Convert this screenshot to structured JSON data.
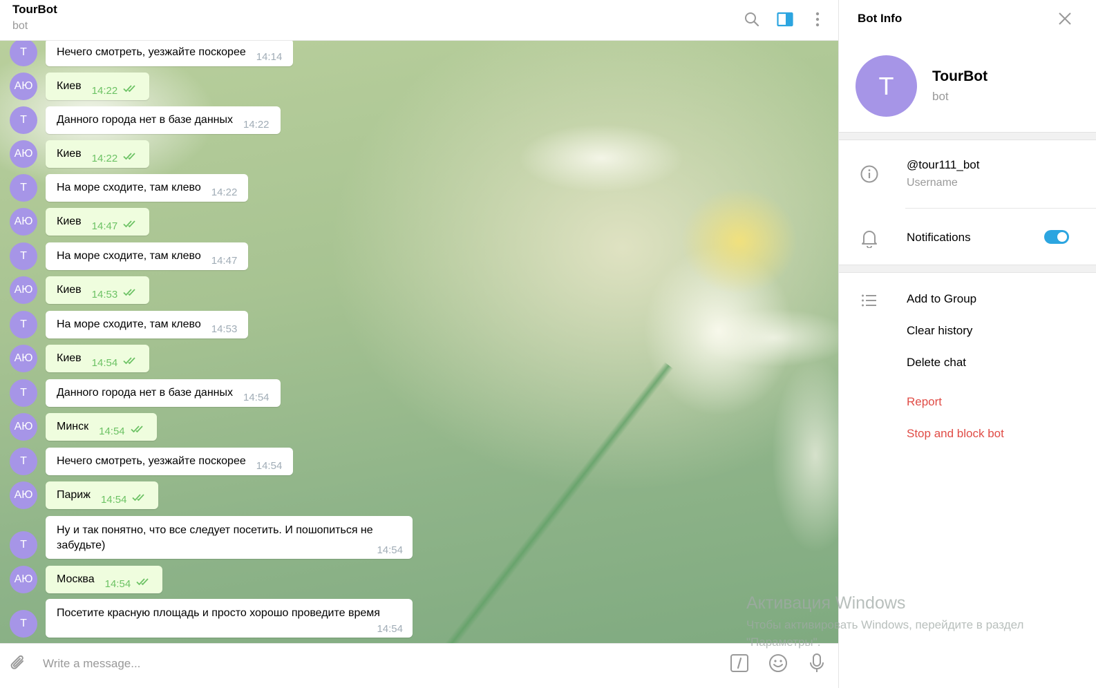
{
  "chat": {
    "title": "TourBot",
    "subtitle": "bot",
    "composer_placeholder": "Write a message..."
  },
  "icons": {
    "search": "search-icon",
    "sidebar_toggle": "sidebar-toggle-icon",
    "more": "more-vertical-icon",
    "attach": "paperclip-icon",
    "commands": "slash-commands-icon",
    "emoji": "emoji-icon",
    "mic": "microphone-icon",
    "close": "close-icon",
    "info": "info-icon",
    "bell": "bell-icon",
    "list": "list-icon",
    "read_receipt": "double-check-icon"
  },
  "colors": {
    "avatar": "#a695e7",
    "outgoing_bubble": "#effdde",
    "outgoing_time": "#6cc264",
    "accent": "#2ca5e0",
    "danger": "#e04c46"
  },
  "messages": [
    {
      "dir": "in",
      "avatar": "T",
      "text": "Нечего смотреть, уезжайте поскорее",
      "time": "14:14"
    },
    {
      "dir": "out",
      "avatar": "АЮ",
      "text": "Киев",
      "time": "14:22"
    },
    {
      "dir": "in",
      "avatar": "T",
      "text": "Данного города нет в базе данных",
      "time": "14:22"
    },
    {
      "dir": "out",
      "avatar": "АЮ",
      "text": "Киев",
      "time": "14:22"
    },
    {
      "dir": "in",
      "avatar": "T",
      "text": "На море сходите, там клево",
      "time": "14:22"
    },
    {
      "dir": "out",
      "avatar": "АЮ",
      "text": "Киев",
      "time": "14:47"
    },
    {
      "dir": "in",
      "avatar": "T",
      "text": "На море сходите, там клево",
      "time": "14:47"
    },
    {
      "dir": "out",
      "avatar": "АЮ",
      "text": "Киев",
      "time": "14:53"
    },
    {
      "dir": "in",
      "avatar": "T",
      "text": "На море сходите, там клево",
      "time": "14:53"
    },
    {
      "dir": "out",
      "avatar": "АЮ",
      "text": "Киев",
      "time": "14:54"
    },
    {
      "dir": "in",
      "avatar": "T",
      "text": "Данного города нет в базе данных",
      "time": "14:54"
    },
    {
      "dir": "out",
      "avatar": "АЮ",
      "text": "Минск",
      "time": "14:54"
    },
    {
      "dir": "in",
      "avatar": "T",
      "text": "Нечего смотреть, уезжайте поскорее",
      "time": "14:54"
    },
    {
      "dir": "out",
      "avatar": "АЮ",
      "text": "Париж",
      "time": "14:54"
    },
    {
      "dir": "in",
      "avatar": "T",
      "text": "Ну и так понятно, что все следует посетить. И пошопиться не забудьте)",
      "time": "14:54"
    },
    {
      "dir": "out",
      "avatar": "АЮ",
      "text": "Москва",
      "time": "14:54"
    },
    {
      "dir": "in",
      "avatar": "T",
      "text": "Посетите красную площадь и просто хорошо проведите время",
      "time": "14:54"
    }
  ],
  "info_panel": {
    "title": "Bot Info",
    "avatar_letter": "T",
    "name": "TourBot",
    "status": "bot",
    "username": "@tour111_bot",
    "username_label": "Username",
    "notifications_label": "Notifications",
    "notifications_on": true,
    "actions": [
      "Add to Group",
      "Clear history",
      "Delete chat"
    ],
    "danger_actions": [
      "Report",
      "Stop and block bot"
    ]
  },
  "watermark": {
    "line1": "Активация Windows",
    "line2": "Чтобы активировать Windows, перейдите в раздел",
    "line3": "\"Параметры\"."
  }
}
